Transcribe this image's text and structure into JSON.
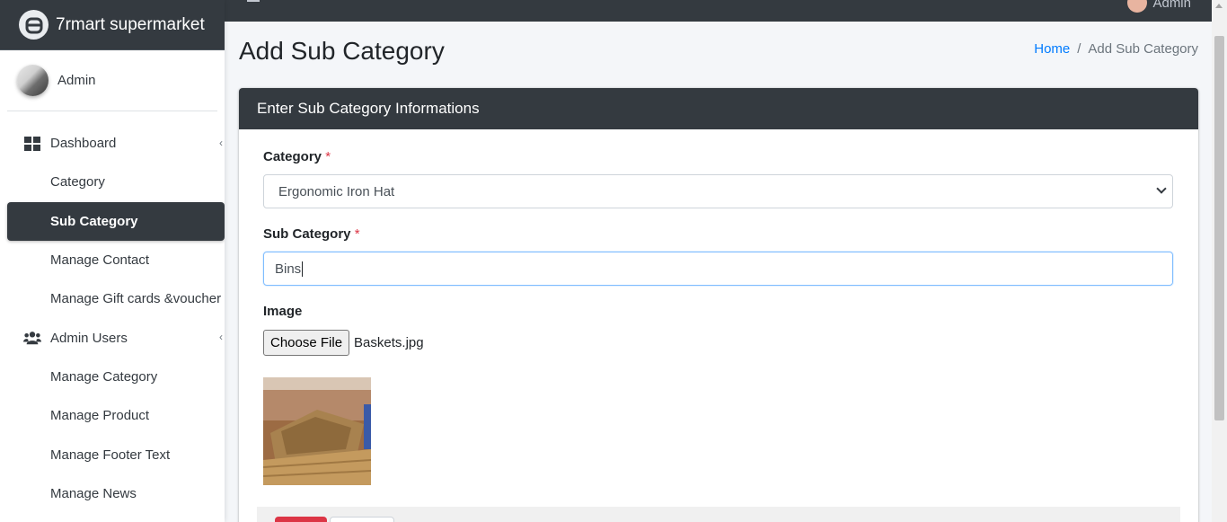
{
  "brand": {
    "name": "7rmart supermarket"
  },
  "user": {
    "name": "Admin"
  },
  "topbar": {
    "user_label": "Admin"
  },
  "sidebar": {
    "items": [
      {
        "label": "Dashboard",
        "icon": "dashboard-icon",
        "type": "parent"
      },
      {
        "label": "Category",
        "type": "sub"
      },
      {
        "label": "Sub Category",
        "type": "sub",
        "active": true
      },
      {
        "label": "Manage Contact",
        "type": "sub"
      },
      {
        "label": "Manage Gift cards &voucher",
        "type": "sub"
      },
      {
        "label": "Admin Users",
        "icon": "users-icon",
        "type": "parent"
      },
      {
        "label": "Manage Category",
        "type": "sub"
      },
      {
        "label": "Manage Product",
        "type": "sub"
      },
      {
        "label": "Manage Footer Text",
        "type": "sub"
      },
      {
        "label": "Manage News",
        "type": "sub"
      }
    ]
  },
  "page": {
    "title": "Add Sub Category",
    "breadcrumb": {
      "home": "Home",
      "separator": "/",
      "current": "Add Sub Category"
    }
  },
  "card": {
    "header": "Enter Sub Category Informations",
    "category": {
      "label": "Category",
      "required": "*",
      "value": "Ergonomic Iron Hat"
    },
    "sub_category": {
      "label": "Sub Category",
      "required": "*",
      "value": "Bins"
    },
    "image": {
      "label": "Image",
      "button": "Choose File",
      "file_name": "Baskets.jpg"
    }
  },
  "colors": {
    "dark": "#343a40",
    "link": "#007bff",
    "required": "#dc3545",
    "focus_border": "#80bdff"
  }
}
